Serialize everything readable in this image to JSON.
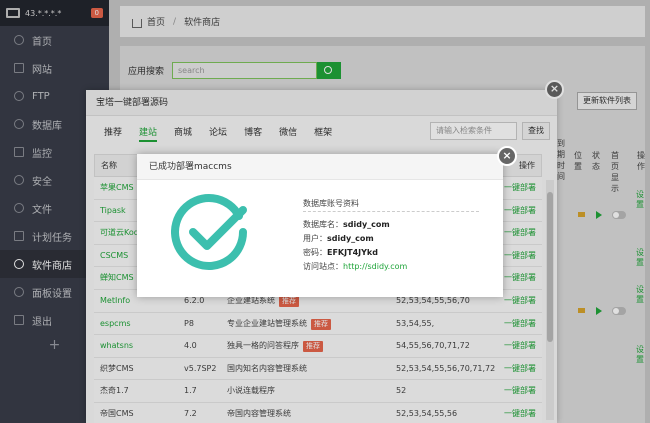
{
  "sidebar": {
    "ip": "43.*.*.*.*",
    "badge": "0",
    "items": [
      {
        "label": "首页",
        "icon": "home-icon"
      },
      {
        "label": "网站",
        "icon": "globe-icon"
      },
      {
        "label": "FTP",
        "icon": "ftp-icon"
      },
      {
        "label": "数据库",
        "icon": "database-icon"
      },
      {
        "label": "监控",
        "icon": "monitor-icon"
      },
      {
        "label": "安全",
        "icon": "shield-icon"
      },
      {
        "label": "文件",
        "icon": "folder-icon"
      },
      {
        "label": "计划任务",
        "icon": "clock-icon"
      },
      {
        "label": "软件商店",
        "icon": "grid-icon"
      },
      {
        "label": "面板设置",
        "icon": "settings-icon"
      },
      {
        "label": "退出",
        "icon": "logout-icon"
      }
    ],
    "plus": "+"
  },
  "breadcrumb": {
    "home": "首页",
    "sep": "/",
    "current": "软件商店"
  },
  "store": {
    "search_label": "应用搜索",
    "search_placeholder": "search",
    "update_button": "更新软件列表",
    "bg_headers": [
      "到期时间",
      "位置",
      "状态",
      "首页显示",
      "操作"
    ],
    "bg_tags": [
      "设置",
      "设置",
      "设置",
      "设置"
    ]
  },
  "deploy": {
    "title": "宝塔一键部署源码",
    "tabs": [
      "推荐",
      "建站",
      "商城",
      "论坛",
      "博客",
      "微信",
      "框架"
    ],
    "active_tab": 1,
    "search_placeholder": "请输入检索条件",
    "search_button": "查找",
    "columns": {
      "name": "名称",
      "op": "操作"
    },
    "recommend_label": "推荐",
    "rows": [
      {
        "name": "苹果CMS",
        "version": "",
        "desc": "",
        "rec": false,
        "php": "",
        "op": "一键部署",
        "green": true
      },
      {
        "name": "Tipask",
        "version": "",
        "desc": "",
        "rec": false,
        "php": "",
        "op": "一键部署",
        "green": true
      },
      {
        "name": "可道云Kod",
        "version": "",
        "desc": "",
        "rec": false,
        "php": "",
        "op": "一键部署",
        "green": true
      },
      {
        "name": "CSCMS",
        "version": "",
        "desc": "",
        "rec": false,
        "php": "",
        "op": "一键部署",
        "green": true
      },
      {
        "name": "蝉知CMS",
        "version": "",
        "desc": "",
        "rec": false,
        "php": "",
        "op": "一键部署",
        "green": true
      },
      {
        "name": "MetInfo",
        "version": "6.2.0",
        "desc": "企业建站系统",
        "rec": true,
        "php": "52,53,54,55,56,70",
        "op": "一键部署",
        "green": true
      },
      {
        "name": "espcms",
        "version": "P8",
        "desc": "专业企业建站管理系统",
        "rec": true,
        "php": "53,54,55,",
        "op": "一键部署",
        "green": true
      },
      {
        "name": "whatsns",
        "version": "4.0",
        "desc": "独具一格的问答程序",
        "rec": true,
        "php": "54,55,56,70,71,72",
        "op": "一键部署",
        "green": true
      },
      {
        "name": "织梦CMS",
        "version": "v5.7SP2",
        "desc": "国内知名内容管理系统",
        "rec": false,
        "php": "52,53,54,55,56,70,71,72",
        "op": "一键部署",
        "green": false
      },
      {
        "name": "杰奇1.7",
        "version": "1.7",
        "desc": "小说连载程序",
        "rec": false,
        "php": "52",
        "op": "一键部署",
        "green": false
      },
      {
        "name": "帝国CMS",
        "version": "7.2",
        "desc": "帝国内容管理系统",
        "rec": false,
        "php": "52,53,54,55,56",
        "op": "一键部署",
        "green": false
      }
    ]
  },
  "success": {
    "title": "已成功部署maccms",
    "info_title": "数据库账号资料",
    "db_label": "数据库名：",
    "db_value": "sdidy_com",
    "user_label": "用户：",
    "user_value": "sdidy_com",
    "pass_label": "密码：",
    "pass_value": "EFKJT4JYkd",
    "site_label": "访问站点：",
    "site_value": "http://sdidy.com",
    "close": "×"
  },
  "colors": {
    "accent": "#20a53a",
    "sidebar": "#393d49",
    "recommend": "#e8664c",
    "check": "#3cbfae"
  }
}
